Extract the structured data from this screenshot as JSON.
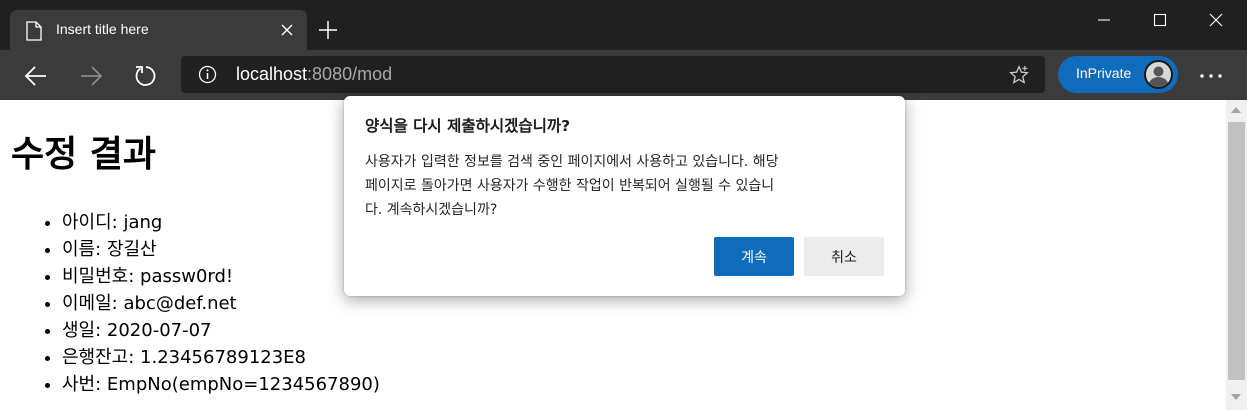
{
  "browser": {
    "tab_title": "Insert title here",
    "url_host": "localhost",
    "url_rest": ":8080/mod",
    "inprivate_label": "InPrivate"
  },
  "page": {
    "title": "수정 결과",
    "items": [
      "아이디: jang",
      "이름: 장길산",
      "비밀번호: passw0rd!",
      "이메일: abc@def.net",
      "생일: 2020-07-07",
      "은행잔고: 1.23456789123E8",
      "사번: EmpNo(empNo=1234567890)"
    ]
  },
  "dialog": {
    "title": "양식을 다시 제출하시겠습니까?",
    "body_lines": [
      "사용자가 입력한 정보를 검색 중인 페이지에서 사용하고 있습니다. 해당",
      "페이지로 돌아가면 사용자가 수행한 작업이 반복되어 실행될 수 있습니",
      "다. 계속하시겠습니까?"
    ],
    "continue_label": "계속",
    "cancel_label": "취소"
  },
  "colors": {
    "accent": "#0f6cbd",
    "titlebar": "#202020",
    "toolbar": "#3b3b3b"
  },
  "icons": [
    "document-icon",
    "close-icon",
    "plus-icon",
    "minimize-icon",
    "maximize-icon",
    "window-close-icon",
    "back-arrow-icon",
    "forward-arrow-icon",
    "refresh-icon",
    "info-icon",
    "star-icon",
    "avatar",
    "more-icon"
  ]
}
